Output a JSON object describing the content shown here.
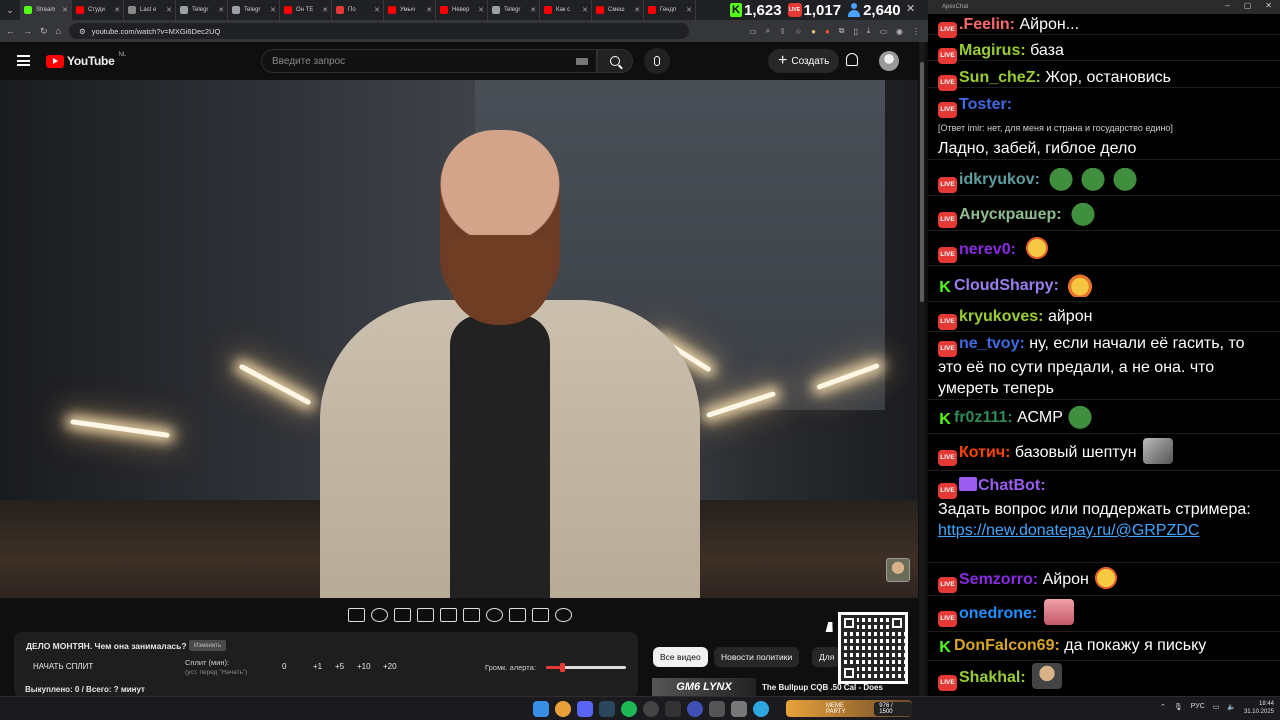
{
  "browser": {
    "tabs": [
      {
        "label": "Stream",
        "color": "#53fc18"
      },
      {
        "label": "Студи",
        "color": "#ff0000"
      },
      {
        "label": "Last e",
        "color": "#888888"
      },
      {
        "label": "Telegr",
        "color": "#9aa0a6"
      },
      {
        "label": "Telegr",
        "color": "#9aa0a6"
      },
      {
        "label": "Он ТЕ",
        "color": "#ff0000"
      },
      {
        "label": "По",
        "color": "#e53935"
      },
      {
        "label": "Умыч",
        "color": "#ff0000"
      },
      {
        "label": "Невер",
        "color": "#ff0000"
      },
      {
        "label": "Telegr",
        "color": "#9aa0a6"
      },
      {
        "label": "Как с",
        "color": "#ff0000"
      },
      {
        "label": "Смеш",
        "color": "#ff0000"
      },
      {
        "label": "Гендп",
        "color": "#ff0000"
      }
    ],
    "url": "youtube.com/watch?v=MXGi6Dec2UQ"
  },
  "stream_stats": {
    "kick": "1,623",
    "live": "1,017",
    "viewers": "2,640"
  },
  "youtube": {
    "logo_text": "YouTube",
    "region": "NL",
    "search_placeholder": "Введите запрос",
    "create_label": "Создать",
    "chips": [
      "Все видео",
      "Новости политики",
      "Для"
    ],
    "related_title": "The Bullpup CQB .50 Cal - Does",
    "related_thumb_text": "GM6 LYNX"
  },
  "split_panel": {
    "title": "ДЕЛО МОНТЯН. Чем она занималась?",
    "change_label": "Изменить",
    "start_label": "НАЧАТЬ СПЛИТ",
    "split_label": "Сплит (мин):",
    "split_hint": "(уст. перед \"Начать\")",
    "split_value": "0",
    "add_buttons": [
      "+1",
      "+5",
      "+10",
      "+20"
    ],
    "volume_label": "Громк. алерта:",
    "volume_level": 0.2,
    "footer": "Выкуплено: 0 / Всего: ? минут"
  },
  "chat": {
    "window_title": "ApexChat",
    "messages": [
      {
        "platform": "live",
        "user": ".Feelin:",
        "color": "#ff6b6b",
        "text": "Айрон..."
      },
      {
        "platform": "live",
        "user": "Magirus:",
        "color": "#9acd32",
        "text": "база"
      },
      {
        "platform": "live",
        "user": "Sun_cheZ:",
        "color": "#9acd32",
        "text": "Жор, остановись"
      },
      {
        "platform": "live",
        "user": "Toster:",
        "color": "#4169e1",
        "reply": "[Ответ imir: нет, для меня и страна и государство едино]",
        "text": "Ладно, забей, гиблое дело"
      },
      {
        "platform": "live",
        "user": "idkryukov:",
        "color": "#5f9ea0",
        "text": ""
      },
      {
        "platform": "live",
        "user": "Анускрашер:",
        "color": "#8fbc8f",
        "text": ""
      },
      {
        "platform": "live",
        "user": "nerev0:",
        "color": "#8a2be2",
        "text": ""
      },
      {
        "platform": "kick",
        "user": "CloudSharpy:",
        "color": "#9b7ff0",
        "text": ""
      },
      {
        "platform": "live",
        "user": "kryukoves:",
        "color": "#9acd32",
        "text": "айрон"
      },
      {
        "platform": "live",
        "user": "ne_tvoy:",
        "color": "#4169e1",
        "text": "ну, если начали её гасить, то это её по сути предали, а не она. что умереть теперь"
      },
      {
        "platform": "kick",
        "user": "fr0z111:",
        "color": "#2e8b57",
        "text": "АСМР"
      },
      {
        "platform": "live",
        "user": "Котич:",
        "color": "#ff4500",
        "text": "базовый шептун"
      },
      {
        "platform": "live",
        "user": "ChatBot:",
        "color": "#9b5cf0",
        "text": "Задать вопрос или поддержать стримера:",
        "link": "https://new.donatepay.ru/@GRPZDC"
      },
      {
        "platform": "live",
        "user": "Semzorro:",
        "color": "#8a2be2",
        "text": "Айрон"
      },
      {
        "platform": "live",
        "user": "onedrone:",
        "color": "#1e90ff",
        "text": ""
      },
      {
        "platform": "kick",
        "user": "DonFalcon69:",
        "color": "#daa520",
        "text": "да покажу я письку"
      },
      {
        "platform": "live",
        "user": "Shakhal:",
        "color": "#9acd32",
        "text": ""
      }
    ]
  },
  "taskbar": {
    "widget_label": "MEME PARTY",
    "widget_value": "976 / 1500",
    "lang": "РУС",
    "time": "18:44",
    "date": "31.10.2025"
  },
  "icons": {
    "live_badge": "live-badge-icon",
    "kick_badge": "kick-icon"
  }
}
